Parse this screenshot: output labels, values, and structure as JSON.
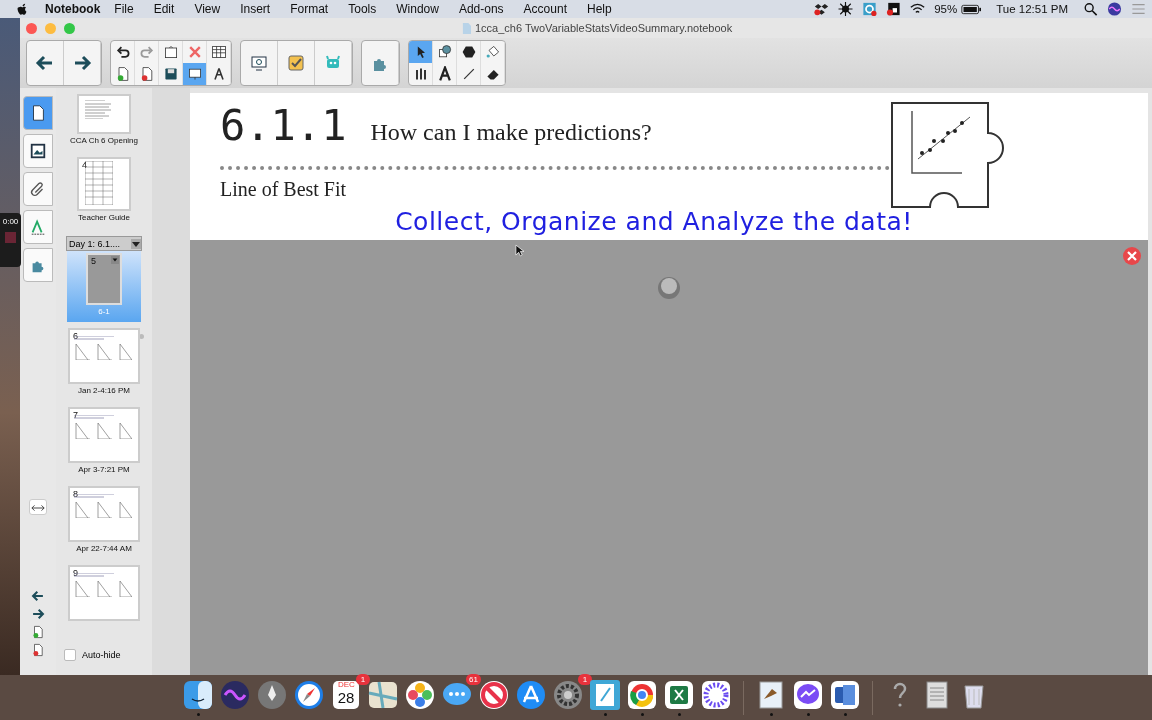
{
  "menu_bar": {
    "app": "Notebook",
    "items": [
      "File",
      "Edit",
      "View",
      "Insert",
      "Format",
      "Tools",
      "Window",
      "Add-ons",
      "Account",
      "Help"
    ],
    "battery": "95%",
    "clock": "Tue 12:51 PM"
  },
  "window": {
    "title": "1cca_ch6 TwoVariableStatsVideoSummary.notebook"
  },
  "toolbar": {
    "groups": [
      {
        "kind": "large",
        "tools": [
          {
            "kind": "back",
            "selected": false
          },
          {
            "kind": "forward",
            "selected": false
          }
        ]
      },
      {
        "kind": "grid",
        "tools": [
          {
            "kind": "undo",
            "selected": false
          },
          {
            "kind": "redo",
            "selected": false
          },
          {
            "kind": "paste",
            "selected": false
          },
          {
            "kind": "delete",
            "selected": false
          },
          {
            "kind": "table",
            "selected": false
          },
          {
            "kind": "add-page",
            "selected": false
          },
          {
            "kind": "delete-page",
            "selected": false
          },
          {
            "kind": "save",
            "selected": false
          },
          {
            "kind": "screen",
            "selected": true
          },
          {
            "kind": "measure",
            "selected": false
          }
        ]
      },
      {
        "kind": "large",
        "tools": [
          {
            "kind": "display",
            "selected": false
          },
          {
            "kind": "check",
            "selected": false
          },
          {
            "kind": "robot",
            "selected": false
          }
        ]
      },
      {
        "kind": "large",
        "tools": [
          {
            "kind": "puzzle",
            "selected": false
          }
        ]
      },
      {
        "kind": "grid",
        "tools": [
          {
            "kind": "pointer",
            "selected": true
          },
          {
            "kind": "shape",
            "selected": false
          },
          {
            "kind": "fill-shape",
            "selected": false
          },
          {
            "kind": "paint",
            "selected": false
          },
          {
            "kind": "pens",
            "selected": false
          },
          {
            "kind": "text",
            "selected": false
          },
          {
            "kind": "line",
            "selected": false
          },
          {
            "kind": "eraser",
            "selected": false
          }
        ]
      }
    ]
  },
  "side_tabs": [
    {
      "kind": "page",
      "selected": true
    },
    {
      "kind": "gallery",
      "selected": false
    },
    {
      "kind": "attach",
      "selected": false
    },
    {
      "kind": "props",
      "selected": false
    },
    {
      "kind": "addon",
      "selected": false
    }
  ],
  "recorder": {
    "time": "0:00"
  },
  "page_sorter": {
    "pages": [
      {
        "label": "CCA Ch 6 Opening",
        "selected": false,
        "kind": "doc"
      },
      {
        "number": "4",
        "label": "Teacher Guide",
        "selected": false,
        "kind": "table"
      },
      {
        "group": "Day 1: 6.1....",
        "number": "5",
        "label": "6-1",
        "selected": true,
        "kind": "blank"
      },
      {
        "number": "6",
        "label": "Jan 2-4:16 PM",
        "selected": false,
        "kind": "graphs"
      },
      {
        "number": "7",
        "label": "Apr 3-7:21 PM",
        "selected": false,
        "kind": "graphs"
      },
      {
        "number": "8",
        "label": "Apr 22-7:44 AM",
        "selected": false,
        "kind": "graphs"
      },
      {
        "number": "9",
        "selected": false,
        "kind": "graphs"
      }
    ],
    "auto_hide": {
      "label": "Auto-hide",
      "checked": false
    }
  },
  "page": {
    "number": "6.1.1",
    "title": "How can I make predictions?",
    "subtitle": "Line of Best Fit",
    "banner": "Collect, Organize and Analyze the data!"
  },
  "dock": {
    "items": [
      {
        "kind": "face",
        "running": true
      },
      {
        "kind": "orb",
        "running": false
      },
      {
        "kind": "rocket",
        "running": false
      },
      {
        "kind": "compass",
        "running": false
      },
      {
        "kind": "calendar",
        "running": false,
        "month": "DEC",
        "day": "28",
        "badge": "1"
      },
      {
        "kind": "map",
        "running": false
      },
      {
        "kind": "flower",
        "running": false
      },
      {
        "kind": "chat",
        "running": false,
        "badge": "61"
      },
      {
        "kind": "stop",
        "running": false
      },
      {
        "kind": "store",
        "running": false
      },
      {
        "kind": "gear",
        "running": false,
        "badge": "1"
      },
      {
        "kind": "notebook",
        "running": true
      },
      {
        "kind": "chrome",
        "running": true
      },
      {
        "kind": "sheet",
        "running": true
      },
      {
        "kind": "burst",
        "running": false
      },
      {
        "kind": "divider"
      },
      {
        "kind": "bird",
        "running": true
      },
      {
        "kind": "messenger",
        "running": true
      },
      {
        "kind": "doc",
        "running": true
      },
      {
        "kind": "divider"
      },
      {
        "kind": "help",
        "running": false
      },
      {
        "kind": "archive",
        "running": false
      },
      {
        "kind": "trash",
        "running": false
      }
    ]
  }
}
